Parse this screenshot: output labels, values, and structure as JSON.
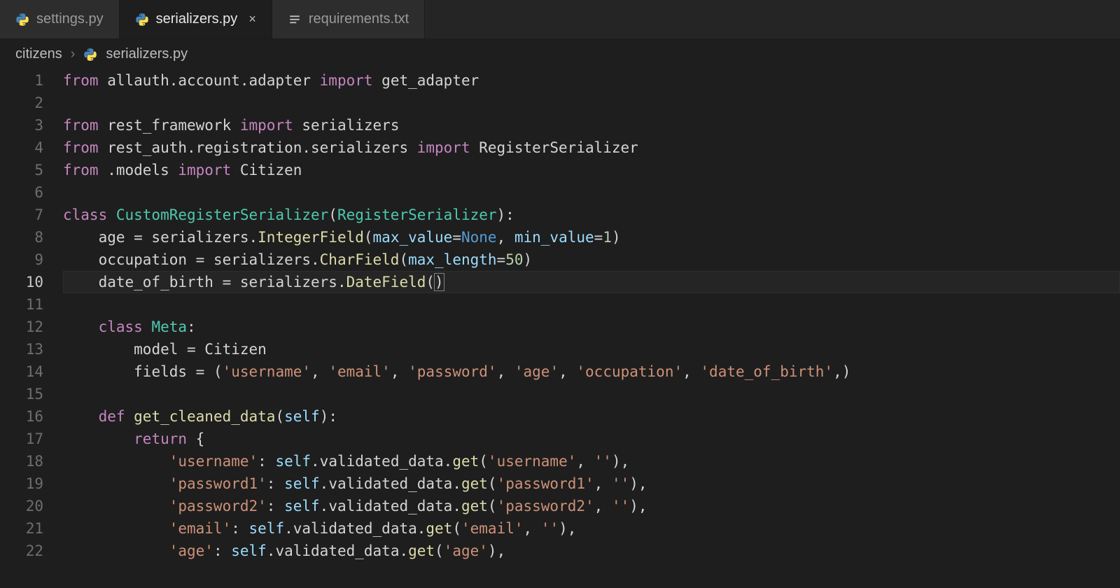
{
  "tabs": [
    {
      "label": "settings.py",
      "icon": "python",
      "active": false,
      "closeable": false
    },
    {
      "label": "serializers.py",
      "icon": "python",
      "active": true,
      "closeable": true
    },
    {
      "label": "requirements.txt",
      "icon": "text",
      "active": false,
      "closeable": false
    }
  ],
  "breadcrumb": {
    "folder": "citizens",
    "file": "serializers.py",
    "file_icon": "python"
  },
  "editor": {
    "active_line": 10,
    "lines": [
      {
        "n": 1,
        "indent": 0,
        "tokens": [
          [
            "kw",
            "from "
          ],
          [
            "id",
            "allauth.account.adapter "
          ],
          [
            "kw",
            "import "
          ],
          [
            "id",
            "get_adapter"
          ]
        ]
      },
      {
        "n": 2,
        "indent": 0,
        "tokens": []
      },
      {
        "n": 3,
        "indent": 0,
        "tokens": [
          [
            "kw",
            "from "
          ],
          [
            "id",
            "rest_framework "
          ],
          [
            "kw",
            "import "
          ],
          [
            "id",
            "serializers"
          ]
        ]
      },
      {
        "n": 4,
        "indent": 0,
        "tokens": [
          [
            "kw",
            "from "
          ],
          [
            "id",
            "rest_auth.registration.serializers "
          ],
          [
            "kw",
            "import "
          ],
          [
            "id",
            "RegisterSerializer"
          ]
        ]
      },
      {
        "n": 5,
        "indent": 0,
        "tokens": [
          [
            "kw",
            "from "
          ],
          [
            "id",
            ".models "
          ],
          [
            "kw",
            "import "
          ],
          [
            "id",
            "Citizen"
          ]
        ]
      },
      {
        "n": 6,
        "indent": 0,
        "tokens": []
      },
      {
        "n": 7,
        "indent": 0,
        "tokens": [
          [
            "kw",
            "class "
          ],
          [
            "cls",
            "CustomRegisterSerializer"
          ],
          [
            "id",
            "("
          ],
          [
            "cls",
            "RegisterSerializer"
          ],
          [
            "id",
            "):"
          ]
        ]
      },
      {
        "n": 8,
        "indent": 1,
        "tokens": [
          [
            "id",
            "age = serializers."
          ],
          [
            "fn",
            "IntegerField"
          ],
          [
            "id",
            "("
          ],
          [
            "param",
            "max_value"
          ],
          [
            "id",
            "="
          ],
          [
            "const",
            "None"
          ],
          [
            "id",
            ", "
          ],
          [
            "param",
            "min_value"
          ],
          [
            "id",
            "="
          ],
          [
            "num",
            "1"
          ],
          [
            "id",
            ")"
          ]
        ]
      },
      {
        "n": 9,
        "indent": 1,
        "tokens": [
          [
            "id",
            "occupation = serializers."
          ],
          [
            "fn",
            "CharField"
          ],
          [
            "id",
            "("
          ],
          [
            "param",
            "max_length"
          ],
          [
            "id",
            "="
          ],
          [
            "num",
            "50"
          ],
          [
            "id",
            ")"
          ]
        ]
      },
      {
        "n": 10,
        "indent": 1,
        "tokens": [
          [
            "id",
            "date_of_birth = serializers."
          ],
          [
            "fn",
            "DateField"
          ],
          [
            "id",
            "("
          ],
          [
            "cursor",
            ")"
          ]
        ]
      },
      {
        "n": 11,
        "indent": 0,
        "tokens": []
      },
      {
        "n": 12,
        "indent": 1,
        "tokens": [
          [
            "kw",
            "class "
          ],
          [
            "cls",
            "Meta"
          ],
          [
            "id",
            ":"
          ]
        ]
      },
      {
        "n": 13,
        "indent": 2,
        "tokens": [
          [
            "id",
            "model = Citizen"
          ]
        ]
      },
      {
        "n": 14,
        "indent": 2,
        "tokens": [
          [
            "id",
            "fields = ("
          ],
          [
            "str",
            "'username'"
          ],
          [
            "id",
            ", "
          ],
          [
            "str",
            "'email'"
          ],
          [
            "id",
            ", "
          ],
          [
            "str",
            "'password'"
          ],
          [
            "id",
            ", "
          ],
          [
            "str",
            "'age'"
          ],
          [
            "id",
            ", "
          ],
          [
            "str",
            "'occupation'"
          ],
          [
            "id",
            ", "
          ],
          [
            "str",
            "'date_of_birth'"
          ],
          [
            "id",
            ",)"
          ]
        ]
      },
      {
        "n": 15,
        "indent": 0,
        "tokens": []
      },
      {
        "n": 16,
        "indent": 1,
        "tokens": [
          [
            "kw",
            "def "
          ],
          [
            "fn",
            "get_cleaned_data"
          ],
          [
            "id",
            "("
          ],
          [
            "self",
            "self"
          ],
          [
            "id",
            "):"
          ]
        ]
      },
      {
        "n": 17,
        "indent": 2,
        "tokens": [
          [
            "kw",
            "return"
          ],
          [
            "id",
            " {"
          ]
        ]
      },
      {
        "n": 18,
        "indent": 3,
        "tokens": [
          [
            "str",
            "'username'"
          ],
          [
            "id",
            ": "
          ],
          [
            "self",
            "self"
          ],
          [
            "id",
            ".validated_data."
          ],
          [
            "fn",
            "get"
          ],
          [
            "id",
            "("
          ],
          [
            "str",
            "'username'"
          ],
          [
            "id",
            ", "
          ],
          [
            "str",
            "''"
          ],
          [
            "id",
            "),"
          ]
        ]
      },
      {
        "n": 19,
        "indent": 3,
        "tokens": [
          [
            "str",
            "'password1'"
          ],
          [
            "id",
            ": "
          ],
          [
            "self",
            "self"
          ],
          [
            "id",
            ".validated_data."
          ],
          [
            "fn",
            "get"
          ],
          [
            "id",
            "("
          ],
          [
            "str",
            "'password1'"
          ],
          [
            "id",
            ", "
          ],
          [
            "str",
            "''"
          ],
          [
            "id",
            "),"
          ]
        ]
      },
      {
        "n": 20,
        "indent": 3,
        "tokens": [
          [
            "str",
            "'password2'"
          ],
          [
            "id",
            ": "
          ],
          [
            "self",
            "self"
          ],
          [
            "id",
            ".validated_data."
          ],
          [
            "fn",
            "get"
          ],
          [
            "id",
            "("
          ],
          [
            "str",
            "'password2'"
          ],
          [
            "id",
            ", "
          ],
          [
            "str",
            "''"
          ],
          [
            "id",
            "),"
          ]
        ]
      },
      {
        "n": 21,
        "indent": 3,
        "tokens": [
          [
            "str",
            "'email'"
          ],
          [
            "id",
            ": "
          ],
          [
            "self",
            "self"
          ],
          [
            "id",
            ".validated_data."
          ],
          [
            "fn",
            "get"
          ],
          [
            "id",
            "("
          ],
          [
            "str",
            "'email'"
          ],
          [
            "id",
            ", "
          ],
          [
            "str",
            "''"
          ],
          [
            "id",
            "),"
          ]
        ]
      },
      {
        "n": 22,
        "indent": 3,
        "tokens": [
          [
            "str",
            "'age'"
          ],
          [
            "id",
            ": "
          ],
          [
            "self",
            "self"
          ],
          [
            "id",
            ".validated_data."
          ],
          [
            "fn",
            "get"
          ],
          [
            "id",
            "("
          ],
          [
            "str",
            "'age'"
          ],
          [
            "id",
            "),"
          ]
        ]
      }
    ]
  }
}
